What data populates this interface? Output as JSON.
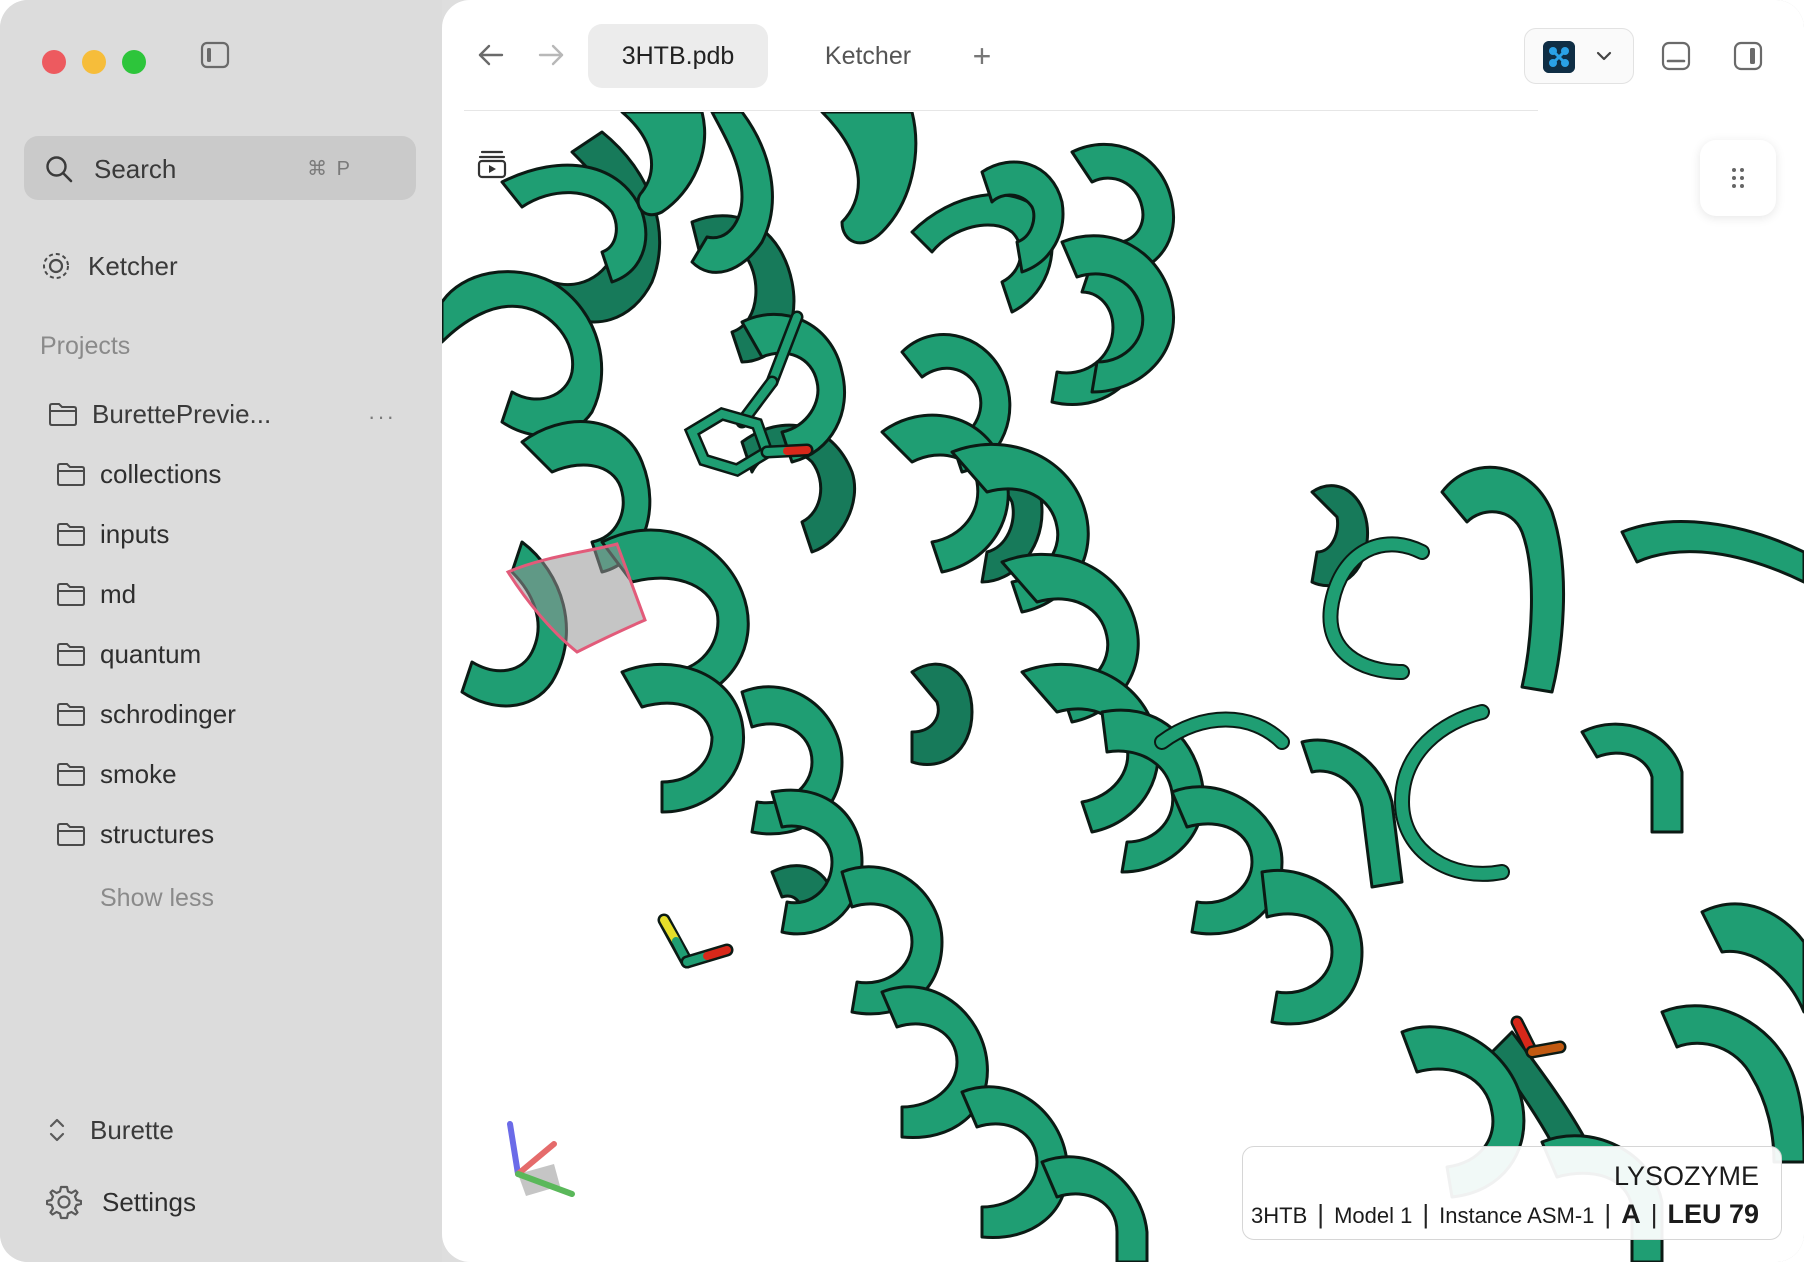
{
  "sidebar": {
    "search": {
      "label": "Search",
      "shortcut": "⌘ P"
    },
    "nav": {
      "ketcher": "Ketcher"
    },
    "projects_heading": "Projects",
    "project": {
      "name": "BurettePrevie...",
      "more": "···"
    },
    "folders": [
      "collections",
      "inputs",
      "md",
      "quantum",
      "schrodinger",
      "smoke",
      "structures"
    ],
    "show_less": "Show less",
    "workspace": "Burette",
    "settings": "Settings"
  },
  "toolbar": {
    "tabs": [
      {
        "label": "3HTB.pdb",
        "active": true
      },
      {
        "label": "Ketcher",
        "active": false
      }
    ],
    "add_tab": "+"
  },
  "viewer": {
    "structure_color": "#1f9e73",
    "info": {
      "title": "LYSOZYME",
      "pdb_id": "3HTB",
      "model": "Model 1",
      "instance": "Instance ASM-1",
      "chain": "A",
      "residue": "LEU 79"
    }
  }
}
